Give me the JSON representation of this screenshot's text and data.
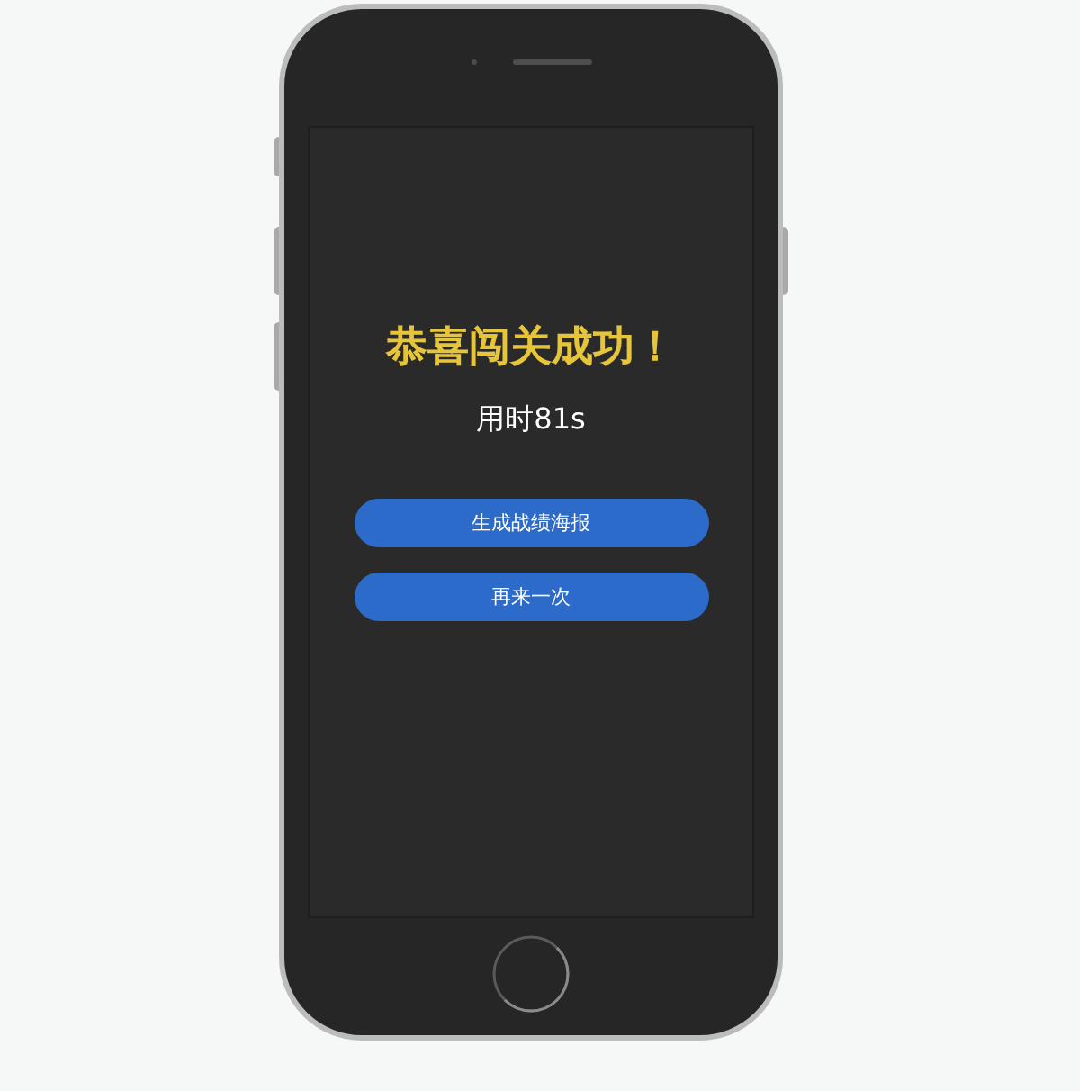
{
  "screen": {
    "title": "恭喜闯关成功！",
    "time_text": "用时81s",
    "buttons": [
      {
        "label": "生成战绩海报"
      },
      {
        "label": "再来一次"
      }
    ]
  }
}
